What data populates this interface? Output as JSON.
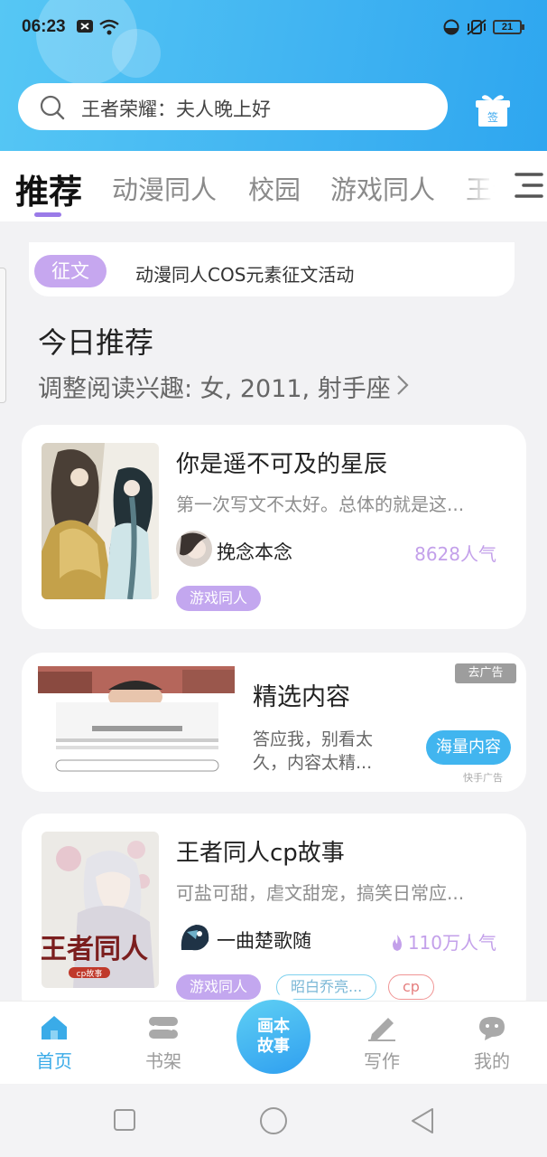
{
  "status_bar": {
    "time": "06:23",
    "battery": "21"
  },
  "search": {
    "placeholder": "王者荣耀：夫人晚上好"
  },
  "gift_label": "签",
  "tabs": [
    {
      "label": "推荐",
      "active": true
    },
    {
      "label": "动漫同人"
    },
    {
      "label": "校园"
    },
    {
      "label": "游戏同人"
    },
    {
      "label": "王者"
    }
  ],
  "banner": {
    "tag": "征文",
    "text": "动漫同人COS元素征文活动"
  },
  "section": {
    "title": "今日推荐",
    "subtitle": "调整阅读兴趣: 女, 2011, 射手座"
  },
  "books": [
    {
      "title": "你是遥不可及的星辰",
      "desc": "第一次写文不太好。总体的就是这...",
      "author": "挽念本念",
      "popularity": "8628人气",
      "tags": [
        "游戏同人"
      ]
    },
    {
      "title": "王者同人cp故事",
      "desc": "可盐可甜，虐文甜宠，搞笑日常应...",
      "author": "一曲楚歌随",
      "popularity": "110万人气",
      "cover_text": "王者同人",
      "cover_sub": "cp故事",
      "tags": [
        "游戏同人",
        "昭白乔亮...",
        "cp"
      ]
    }
  ],
  "ad": {
    "title": "精选内容",
    "desc": "答应我，别看太久，内容太精...",
    "close_label": "去广告",
    "cta": "海量内容",
    "source": "快手广告"
  },
  "bottom_nav": {
    "items": [
      {
        "label": "首页",
        "active": true,
        "icon": "home-icon"
      },
      {
        "label": "书架",
        "icon": "bookshelf-icon"
      },
      {
        "label": "写作",
        "icon": "pen-icon"
      },
      {
        "label": "我的",
        "icon": "chat-bubble-icon"
      }
    ],
    "center_line1": "画本",
    "center_line2": "故事"
  },
  "colors": {
    "accent": "#41b5ef",
    "tag_purple": "#c3a7ef",
    "header_start": "#56c7f4",
    "header_end": "#2ea6ef"
  }
}
